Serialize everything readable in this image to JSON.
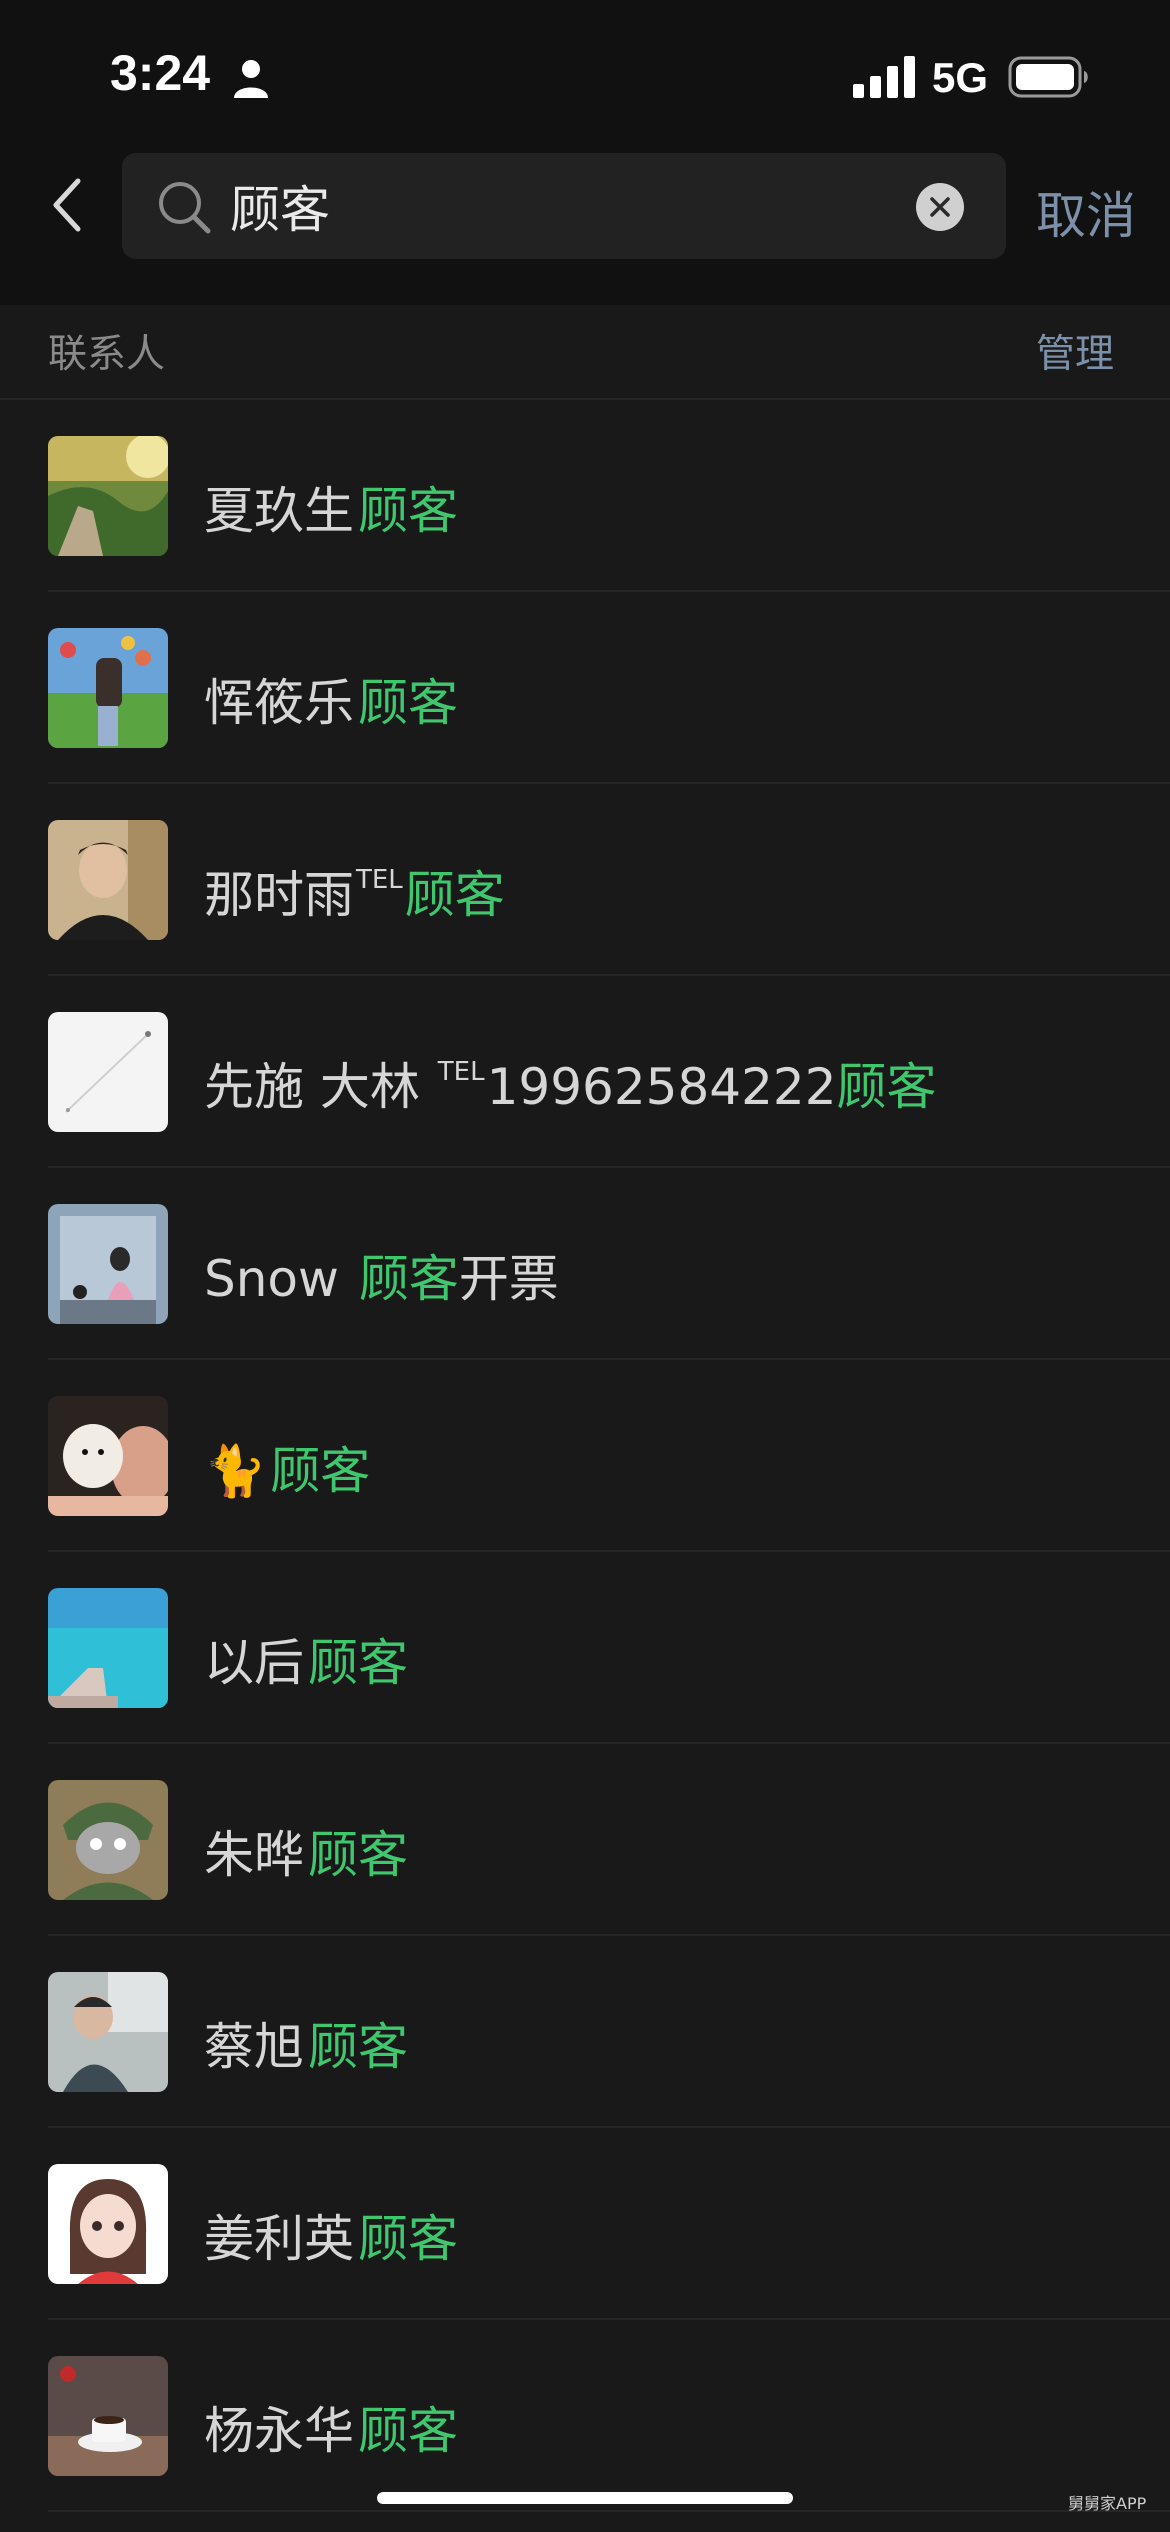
{
  "status_bar": {
    "time": "3:24",
    "network": "5G"
  },
  "search": {
    "query": "顾客",
    "cancel_label": "取消"
  },
  "section": {
    "title": "联系人",
    "manage_label": "管理"
  },
  "highlight_color": "#3fc76e",
  "contacts": [
    {
      "prefix": "夏玖生",
      "tel": "",
      "tel_number": "",
      "highlight": "顾客",
      "suffix": ""
    },
    {
      "prefix": "恽筱乐",
      "tel": "",
      "tel_number": "",
      "highlight": "顾客",
      "suffix": ""
    },
    {
      "prefix": "那时雨",
      "tel": "TEL",
      "tel_number": "",
      "highlight": "顾客",
      "suffix": ""
    },
    {
      "prefix": "先施 大林 ",
      "tel": "TEL",
      "tel_number": "19962584222",
      "highlight": "顾客",
      "suffix": ""
    },
    {
      "prefix": "Snow ",
      "tel": "",
      "tel_number": "",
      "highlight": "顾客",
      "suffix": "开票"
    },
    {
      "prefix": "🐈",
      "tel": "",
      "tel_number": "",
      "highlight": "顾客",
      "suffix": ""
    },
    {
      "prefix": "以后",
      "tel": "",
      "tel_number": "",
      "highlight": "顾客",
      "suffix": ""
    },
    {
      "prefix": "朱晔",
      "tel": "",
      "tel_number": "",
      "highlight": "顾客",
      "suffix": ""
    },
    {
      "prefix": "蔡旭",
      "tel": "",
      "tel_number": "",
      "highlight": "顾客",
      "suffix": ""
    },
    {
      "prefix": "姜利英",
      "tel": "",
      "tel_number": "",
      "highlight": "顾客",
      "suffix": ""
    },
    {
      "prefix": "杨永华",
      "tel": "",
      "tel_number": "",
      "highlight": "顾客",
      "suffix": ""
    }
  ],
  "watermark": "舅舅家APP"
}
